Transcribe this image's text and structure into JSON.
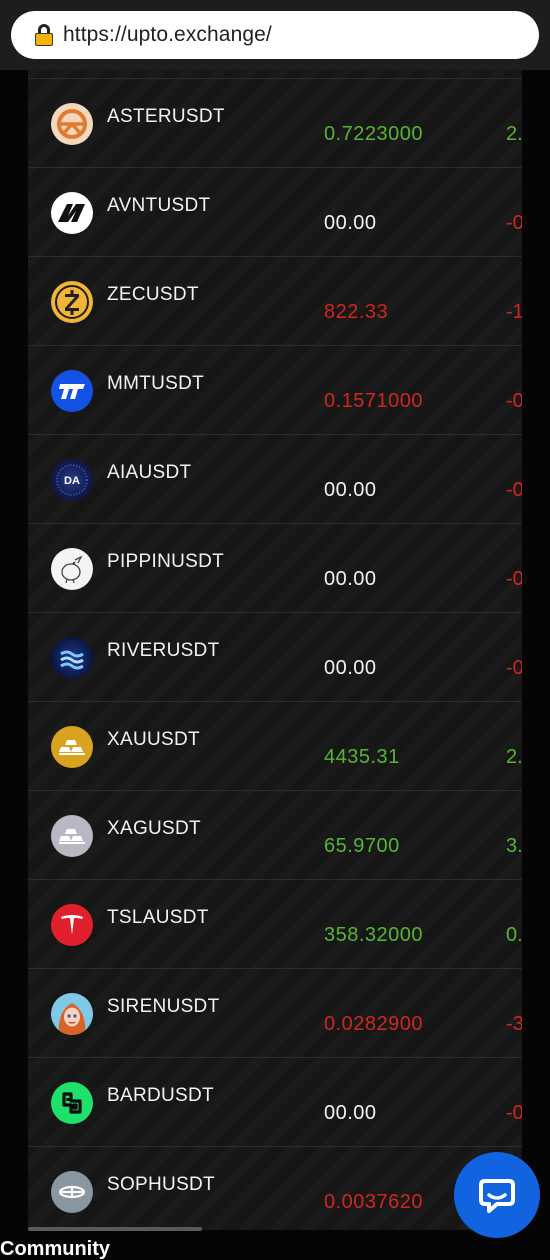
{
  "browser": {
    "url": "https://upto.exchange/"
  },
  "market": {
    "rows": [
      {
        "symbol": "ASTERUSDT",
        "price": "0.7223000",
        "price_trend": "up",
        "change": "2.",
        "change_trend": "up",
        "icon": "aster-coin-icon"
      },
      {
        "symbol": "AVNTUSDT",
        "price": "00.00",
        "price_trend": "neutral",
        "change": "-0",
        "change_trend": "down",
        "icon": "avnt-coin-icon"
      },
      {
        "symbol": "ZECUSDT",
        "price": "822.33",
        "price_trend": "down",
        "change": "-1",
        "change_trend": "down",
        "icon": "zec-coin-icon"
      },
      {
        "symbol": "MMTUSDT",
        "price": "0.1571000",
        "price_trend": "down",
        "change": "-0",
        "change_trend": "down",
        "icon": "mmt-coin-icon"
      },
      {
        "symbol": "AIAUSDT",
        "price": "00.00",
        "price_trend": "neutral",
        "change": "-0",
        "change_trend": "down",
        "icon": "aia-coin-icon"
      },
      {
        "symbol": "PIPPINUSDT",
        "price": "00.00",
        "price_trend": "neutral",
        "change": "-0",
        "change_trend": "down",
        "icon": "pippin-coin-icon"
      },
      {
        "symbol": "RIVERUSDT",
        "price": "00.00",
        "price_trend": "neutral",
        "change": "-0",
        "change_trend": "down",
        "icon": "river-coin-icon"
      },
      {
        "symbol": "XAUUSDT",
        "price": "4435.31",
        "price_trend": "up",
        "change": "2.",
        "change_trend": "up",
        "icon": "gold-bars-icon"
      },
      {
        "symbol": "XAGUSDT",
        "price": "65.9700",
        "price_trend": "up",
        "change": "3.",
        "change_trend": "up",
        "icon": "silver-bars-icon"
      },
      {
        "symbol": "TSLAUSDT",
        "price": "358.32000",
        "price_trend": "up",
        "change": "0.",
        "change_trend": "up",
        "icon": "tesla-logo-icon"
      },
      {
        "symbol": "SIRENUSDT",
        "price": "0.0282900",
        "price_trend": "down",
        "change": "-3",
        "change_trend": "down",
        "icon": "siren-avatar-icon"
      },
      {
        "symbol": "BARDUSDT",
        "price": "00.00",
        "price_trend": "neutral",
        "change": "-0",
        "change_trend": "down",
        "icon": "bard-coin-icon"
      },
      {
        "symbol": "SOPHUSDT",
        "price": "0.0037620",
        "price_trend": "down",
        "change": "",
        "change_trend": "down",
        "icon": "soph-coin-icon"
      }
    ]
  },
  "footer": {
    "community_label": "Community"
  },
  "colors": {
    "up": "#56b531",
    "down": "#d0261f",
    "chat_button": "#1263e0"
  }
}
